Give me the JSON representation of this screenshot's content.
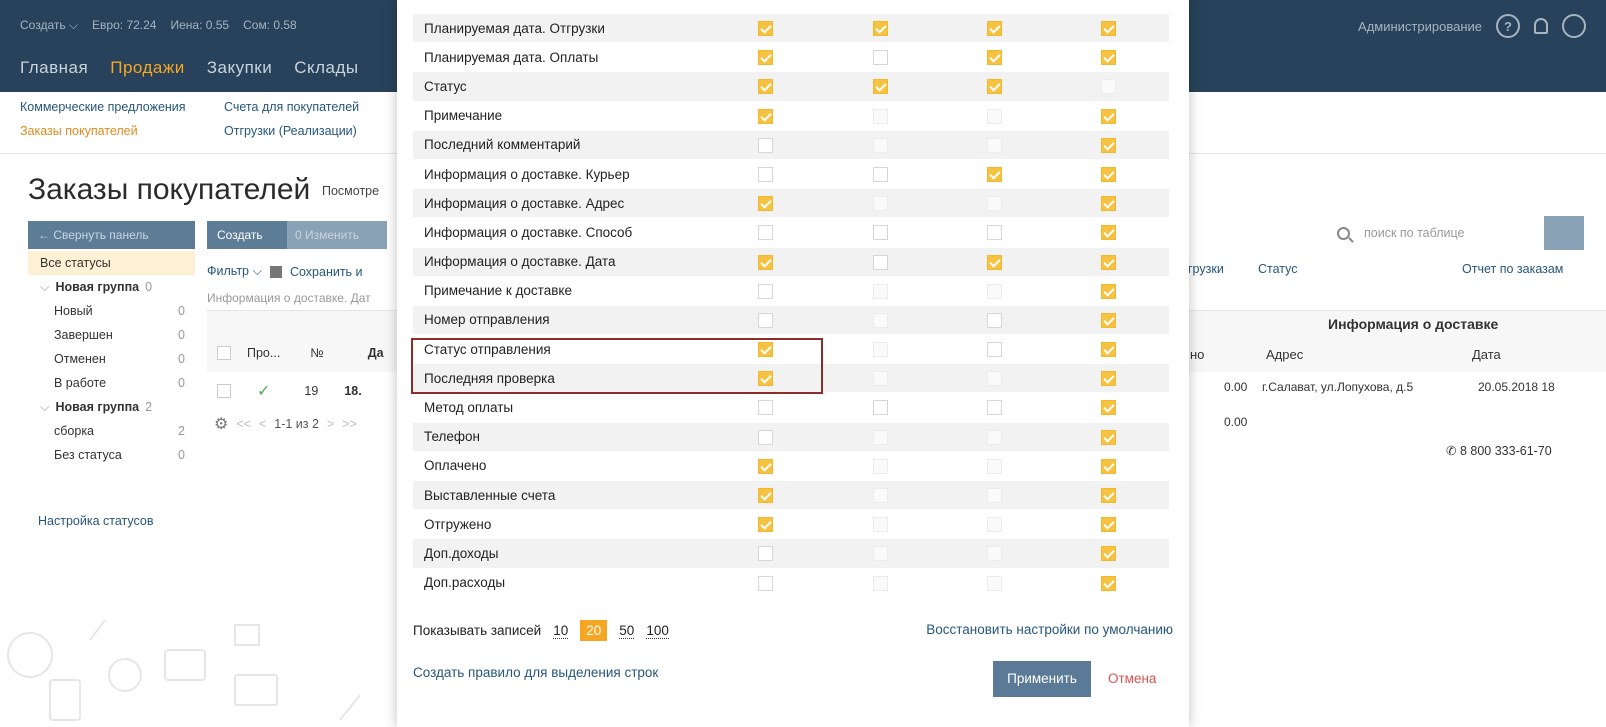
{
  "topbar": {
    "create": "Создать ⌵",
    "currencies": [
      "Евро: 72.24",
      "Иена: 0.55",
      "Сом: 0.58"
    ],
    "admin": "Администрирование",
    "help": "?"
  },
  "main_nav": [
    "Главная",
    "Продажи",
    "Закупки",
    "Склады"
  ],
  "sub_nav": {
    "col1": [
      "Коммерческие предложения",
      "Заказы покупателей"
    ],
    "col2": [
      "Счета для покупателей",
      "Отгрузки (Реализации)"
    ]
  },
  "page": {
    "title": "Заказы покупателей",
    "subtitle": "Посмотре"
  },
  "sidebar": {
    "collapse": "← Свернуть панель",
    "statuses": [
      {
        "label": "Все статусы",
        "count": "",
        "kind": "sel"
      },
      {
        "label": "Новая группа",
        "count": "0",
        "kind": "group"
      },
      {
        "label": "Новый",
        "count": "0",
        "kind": "child"
      },
      {
        "label": "Завершен",
        "count": "0",
        "kind": "child"
      },
      {
        "label": "Отменен",
        "count": "0",
        "kind": "child"
      },
      {
        "label": "В работе",
        "count": "0",
        "kind": "child"
      },
      {
        "label": "Новая группа",
        "count": "2",
        "kind": "group"
      },
      {
        "label": "сборка",
        "count": "2",
        "kind": "child"
      },
      {
        "label": "Без статуса",
        "count": "0",
        "kind": "child"
      }
    ],
    "settings": "Настройка статусов"
  },
  "toolbar": {
    "create": "Создать",
    "edit": "0 Изменить",
    "filter": "Фильтр ⌵",
    "save": "Сохранить и",
    "info": "Информация о доставке. Дат"
  },
  "grid": {
    "col_pro": "Про...",
    "col_no": "№",
    "col_date": "Да",
    "row_no": "19",
    "row_date": "18.",
    "pager_first": "<<",
    "pager_prev": "<",
    "pager_text": "1-1 из 2",
    "pager_next": ">",
    "pager_last": ">>"
  },
  "right": {
    "search_placeholder": "поиск по таблице",
    "link_shipments": "грузки",
    "link_status": "Статус",
    "link_report": "Отчет по заказам",
    "group_header": "Информация о доставке",
    "col_o": "но",
    "col_address": "Адрес",
    "col_date": "Дата",
    "row1_amount": "0.00",
    "row1_address": "г.Салават, ул.Лопухова, д.5",
    "row1_date": "20.05.2018 18",
    "row2_amount": "0.00",
    "phone": "8 800 333-61-70"
  },
  "settings": {
    "rows": [
      {
        "label": "Планируемая дата. Отгрузки",
        "checks": [
          "on",
          "on",
          "on",
          "on"
        ]
      },
      {
        "label": "Планируемая дата. Оплаты",
        "checks": [
          "on",
          "off",
          "on",
          "on"
        ]
      },
      {
        "label": "Статус",
        "checks": [
          "on",
          "on",
          "on",
          "dis"
        ]
      },
      {
        "label": "Примечание",
        "checks": [
          "on",
          "dis",
          "dis",
          "on"
        ]
      },
      {
        "label": "Последний комментарий",
        "checks": [
          "off",
          "dis",
          "dis",
          "on"
        ]
      },
      {
        "label": "Информация о доставке. Курьер",
        "checks": [
          "off",
          "off",
          "on",
          "on"
        ]
      },
      {
        "label": "Информация о доставке. Адрес",
        "checks": [
          "on",
          "dis",
          "dis",
          "on"
        ]
      },
      {
        "label": "Информация о доставке. Способ",
        "checks": [
          "off",
          "off",
          "off",
          "on"
        ]
      },
      {
        "label": "Информация о доставке. Дата",
        "checks": [
          "on",
          "off",
          "on",
          "on"
        ]
      },
      {
        "label": "Примечание к доставке",
        "checks": [
          "off",
          "dis",
          "dis",
          "on"
        ]
      },
      {
        "label": "Номер отправления",
        "checks": [
          "off",
          "dis",
          "off",
          "on"
        ]
      },
      {
        "label": "Статус отправления",
        "checks": [
          "on",
          "dis",
          "off",
          "on"
        ]
      },
      {
        "label": "Последняя проверка",
        "checks": [
          "on",
          "dis",
          "dis",
          "on"
        ]
      },
      {
        "label": "Метод оплаты",
        "checks": [
          "off",
          "off",
          "off",
          "on"
        ]
      },
      {
        "label": "Телефон",
        "checks": [
          "off",
          "dis",
          "dis",
          "on"
        ]
      },
      {
        "label": "Оплачено",
        "checks": [
          "on",
          "dis",
          "dis",
          "on"
        ]
      },
      {
        "label": "Выставленные счета",
        "checks": [
          "on",
          "dis",
          "dis",
          "on"
        ]
      },
      {
        "label": "Отгружено",
        "checks": [
          "on",
          "dis",
          "dis",
          "on"
        ]
      },
      {
        "label": "Доп.доходы",
        "checks": [
          "off",
          "dis",
          "dis",
          "on"
        ]
      },
      {
        "label": "Доп.расходы",
        "checks": [
          "off",
          "dis",
          "dis",
          "on"
        ]
      }
    ],
    "per_page_label": "Показывать записей",
    "per_page_options": [
      "10",
      "20",
      "50",
      "100"
    ],
    "per_page_selected": "20",
    "restore_defaults": "Восстановить настройки по умолчанию",
    "create_rule": "Создать правило для выделения строк",
    "apply": "Применить",
    "cancel": "Отмена"
  },
  "colors": {
    "topbar": "#27425a",
    "accent": "#f5a623",
    "link": "#26567c",
    "checkbox_on": "#f5c242",
    "apply_button": "#5a7a98",
    "cancel_text": "#d9534f",
    "highlight_border": "#8b2e2a"
  }
}
